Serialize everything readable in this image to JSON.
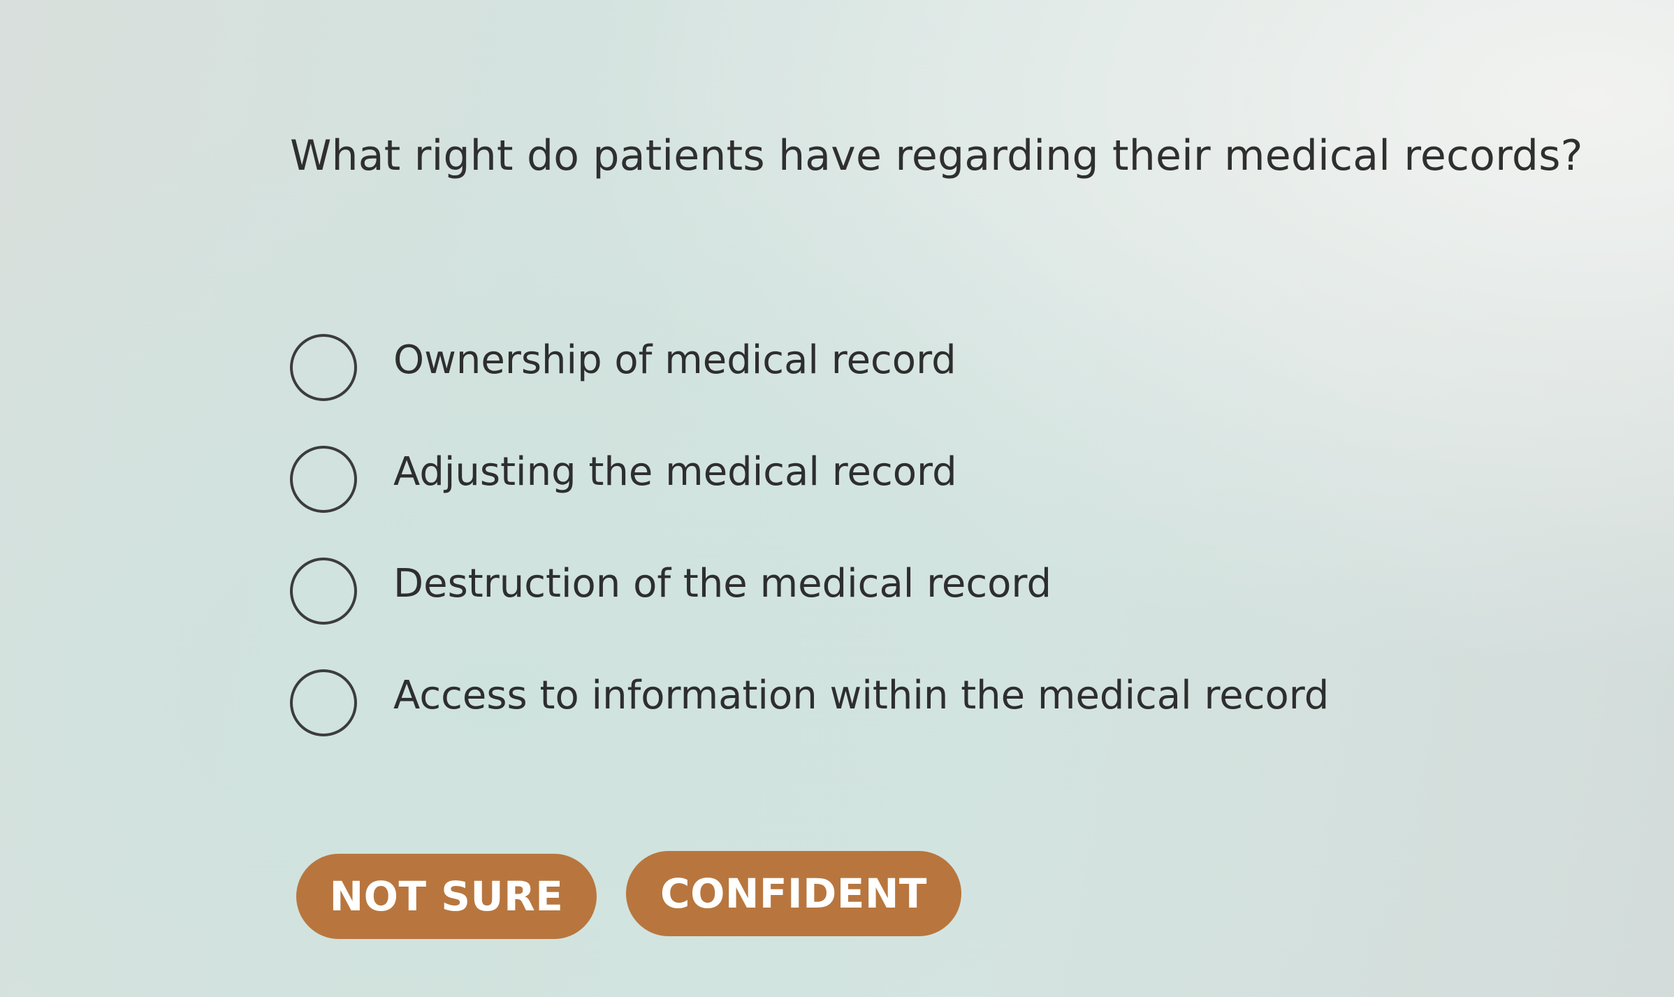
{
  "question": {
    "text": "What right do patients have regarding their medical records?"
  },
  "options": [
    {
      "label": "Ownership of medical record",
      "selected": false
    },
    {
      "label": "Adjusting the medical record",
      "selected": false
    },
    {
      "label": "Destruction of the medical record",
      "selected": false
    },
    {
      "label": "Access to information within the medical record",
      "selected": false
    }
  ],
  "buttons": {
    "not_sure": "NOT SURE",
    "confident": "CONFIDENT"
  },
  "colors": {
    "button_bg": "#b8763e",
    "button_text": "#ffffff",
    "text": "#2e2e2e"
  }
}
